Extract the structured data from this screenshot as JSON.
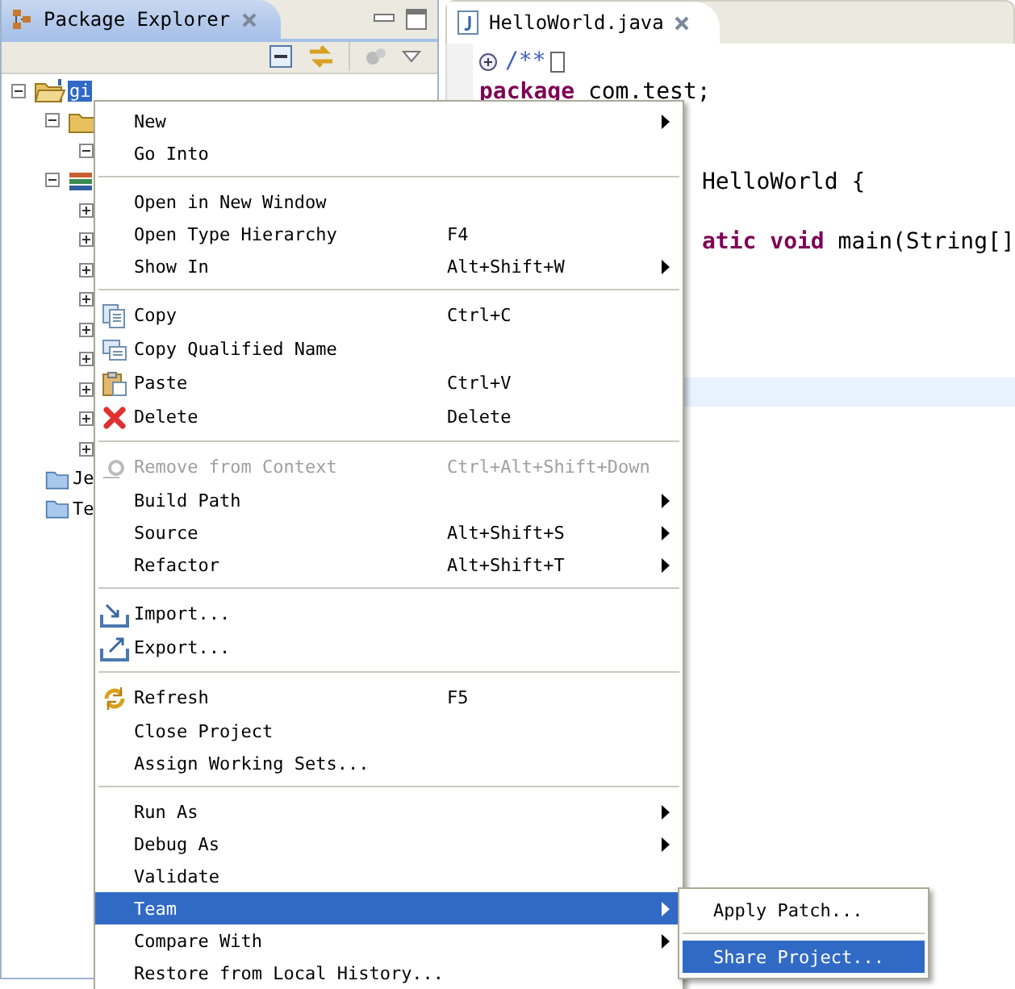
{
  "explorer": {
    "title": "Package Explorer",
    "tree": [
      {
        "label": "gi",
        "kind": "project",
        "expanded": true,
        "selected": true,
        "children": [
          {
            "kind": "package",
            "expanded": true,
            "children": [
              {
                "expanded": true
              }
            ]
          },
          {
            "kind": "library",
            "expanded": true,
            "children": [
              {
                "expanded": false
              },
              {
                "expanded": false
              },
              {
                "expanded": false
              },
              {
                "expanded": false
              },
              {
                "expanded": false
              },
              {
                "expanded": false
              },
              {
                "expanded": false
              },
              {
                "expanded": false
              },
              {
                "expanded": false
              }
            ]
          },
          {
            "label": "Je",
            "kind": "folder"
          },
          {
            "label": "Te",
            "kind": "folder"
          }
        ]
      }
    ]
  },
  "editor": {
    "tab": "HelloWorld.java",
    "lines": [
      {
        "current": false,
        "folded": true,
        "parts": [
          {
            "kind": "comment",
            "text": "/**"
          }
        ]
      },
      {
        "current": false,
        "folded": false,
        "parts": [
          {
            "kind": "keyword",
            "text": "package"
          },
          {
            "kind": "plain",
            "text": " com.test;"
          }
        ]
      },
      {
        "current": false
      },
      {
        "current": false
      },
      {
        "current": false,
        "folded": false,
        "covered": true,
        "parts": [
          {
            "kind": "plain",
            "text": "HelloWorld {"
          }
        ]
      },
      {
        "current": false
      },
      {
        "current": false,
        "folded": false,
        "covered": true,
        "parts": [
          {
            "kind": "keyword",
            "text": "atic void"
          },
          {
            "kind": "plain",
            "text": " main(String[]"
          }
        ]
      },
      {
        "current": false
      },
      {
        "current": false
      },
      {
        "current": false
      },
      {
        "current": false
      },
      {
        "current": true
      }
    ]
  },
  "context_menu": {
    "groups": [
      [
        {
          "label": "New",
          "submenu": true,
          "disabled": false,
          "selected": false
        },
        {
          "label": "Go Into",
          "submenu": false,
          "disabled": false,
          "selected": false
        }
      ],
      [
        {
          "label": "Open in New Window",
          "submenu": false,
          "disabled": false,
          "selected": false
        },
        {
          "label": "Open Type Hierarchy",
          "shortcut": "F4",
          "submenu": false,
          "disabled": false,
          "selected": false
        },
        {
          "label": "Show In",
          "shortcut": "Alt+Shift+W",
          "submenu": true,
          "disabled": false,
          "selected": false
        }
      ],
      [
        {
          "label": "Copy",
          "shortcut": "Ctrl+C",
          "submenu": false,
          "disabled": false,
          "selected": false
        },
        {
          "label": "Copy Qualified Name",
          "submenu": false,
          "disabled": false,
          "selected": false
        },
        {
          "label": "Paste",
          "shortcut": "Ctrl+V",
          "submenu": false,
          "disabled": false,
          "selected": false
        },
        {
          "label": "Delete",
          "shortcut": "Delete",
          "submenu": false,
          "disabled": false,
          "selected": false
        }
      ],
      [
        {
          "label": "Remove from Context",
          "shortcut": "Ctrl+Alt+Shift+Down",
          "submenu": false,
          "disabled": true,
          "selected": false
        },
        {
          "label": "Build Path",
          "submenu": true,
          "disabled": false,
          "selected": false
        },
        {
          "label": "Source",
          "shortcut": "Alt+Shift+S",
          "submenu": true,
          "disabled": false,
          "selected": false
        },
        {
          "label": "Refactor",
          "shortcut": "Alt+Shift+T",
          "submenu": true,
          "disabled": false,
          "selected": false
        }
      ],
      [
        {
          "label": "Import...",
          "submenu": false,
          "disabled": false,
          "selected": false
        },
        {
          "label": "Export...",
          "submenu": false,
          "disabled": false,
          "selected": false
        }
      ],
      [
        {
          "label": "Refresh",
          "shortcut": "F5",
          "submenu": false,
          "disabled": false,
          "selected": false
        },
        {
          "label": "Close Project",
          "submenu": false,
          "disabled": false,
          "selected": false
        },
        {
          "label": "Assign Working Sets...",
          "submenu": false,
          "disabled": false,
          "selected": false
        }
      ],
      [
        {
          "label": "Run As",
          "submenu": true,
          "disabled": false,
          "selected": false
        },
        {
          "label": "Debug As",
          "submenu": true,
          "disabled": false,
          "selected": false
        },
        {
          "label": "Validate",
          "submenu": false,
          "disabled": false,
          "selected": false
        },
        {
          "label": "Team",
          "submenu": true,
          "disabled": false,
          "selected": true
        },
        {
          "label": "Compare With",
          "submenu": true,
          "disabled": false,
          "selected": false
        },
        {
          "label": "Restore from Local History...",
          "submenu": false,
          "disabled": false,
          "selected": false
        }
      ]
    ]
  },
  "submenu": {
    "groups": [
      [
        {
          "label": "Apply Patch...",
          "selected": false
        }
      ],
      [
        {
          "label": "Share Project...",
          "selected": true
        }
      ]
    ]
  }
}
